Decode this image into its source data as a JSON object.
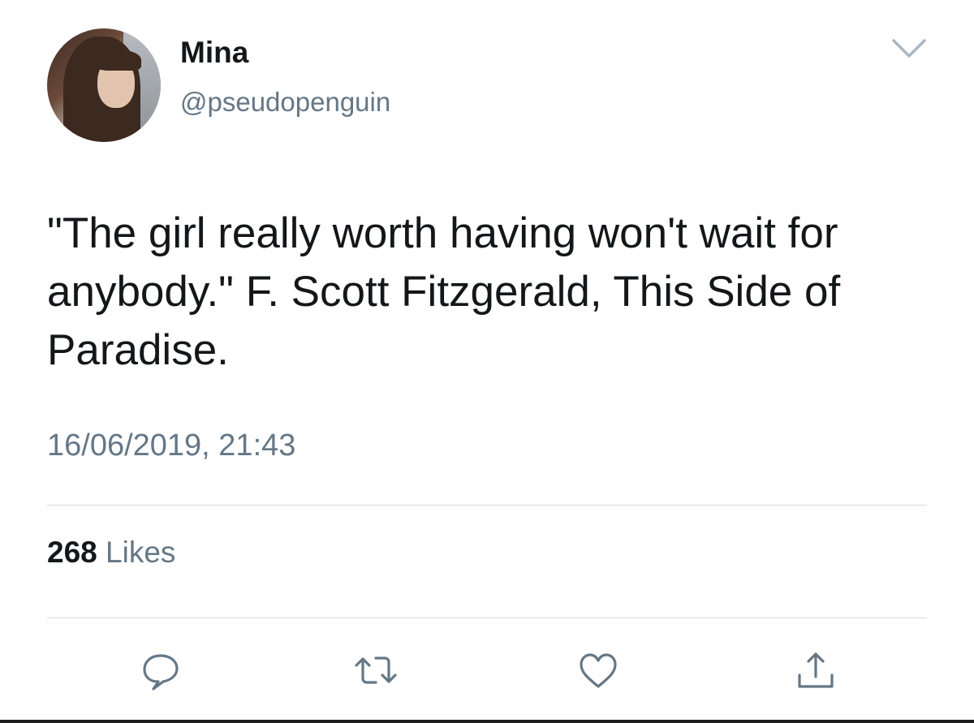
{
  "tweet": {
    "author_name": "Mina",
    "author_handle": "@pseudopenguin",
    "text": "\"The girl really worth having won't wait for anybody.\" F. Scott Fitzgerald, This Side of Paradise.",
    "timestamp": "16/06/2019, 21:43",
    "likes_count": "268",
    "likes_label": "Likes"
  },
  "icons": {
    "menu": "chevron-down-icon",
    "reply": "reply-icon",
    "retweet": "retweet-icon",
    "like": "heart-icon",
    "share": "share-icon"
  },
  "colors": {
    "primary_text": "#14171a",
    "secondary_text": "#657786",
    "divider": "#d6dadd",
    "icon": "#657786"
  }
}
